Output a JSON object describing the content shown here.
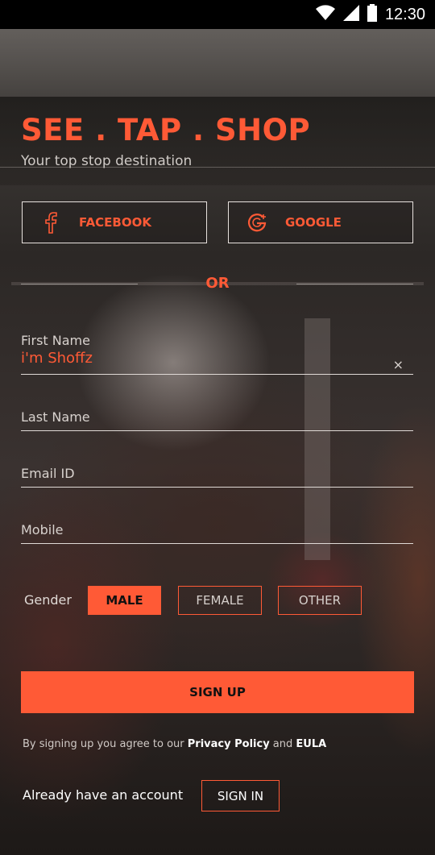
{
  "status_bar": {
    "time": "12:30",
    "icons": [
      "wifi-icon",
      "signal-icon",
      "battery-icon"
    ]
  },
  "header": {
    "title": "SEE . TAP . SHOP",
    "subtitle": "Your top stop destination"
  },
  "social": {
    "facebook_label": "FACEBOOK",
    "google_label": "GOOGLE"
  },
  "divider": {
    "or_text": "OR"
  },
  "form": {
    "first_name": {
      "label": "First Name",
      "value": "i'm Shoffz",
      "clear_glyph": "×"
    },
    "last_name": {
      "label": "Last Name",
      "value": ""
    },
    "email": {
      "label": "Email ID",
      "value": ""
    },
    "mobile": {
      "label": "Mobile",
      "value": ""
    },
    "gender": {
      "label": "Gender",
      "options": [
        "MALE",
        "FEMALE",
        "OTHER"
      ],
      "selected": "MALE"
    }
  },
  "signup": {
    "button_label": "SIGN UP",
    "terms_prefix": "By signing up you agree to our ",
    "privacy_label": "Privacy Policy",
    "terms_and": " and ",
    "eula_label": "EULA"
  },
  "signin": {
    "prompt": "Already have an account",
    "button_label": "SIGN IN"
  },
  "colors": {
    "accent": "#ff5a36",
    "text": "#ffffff",
    "status_bar": "#000000"
  }
}
